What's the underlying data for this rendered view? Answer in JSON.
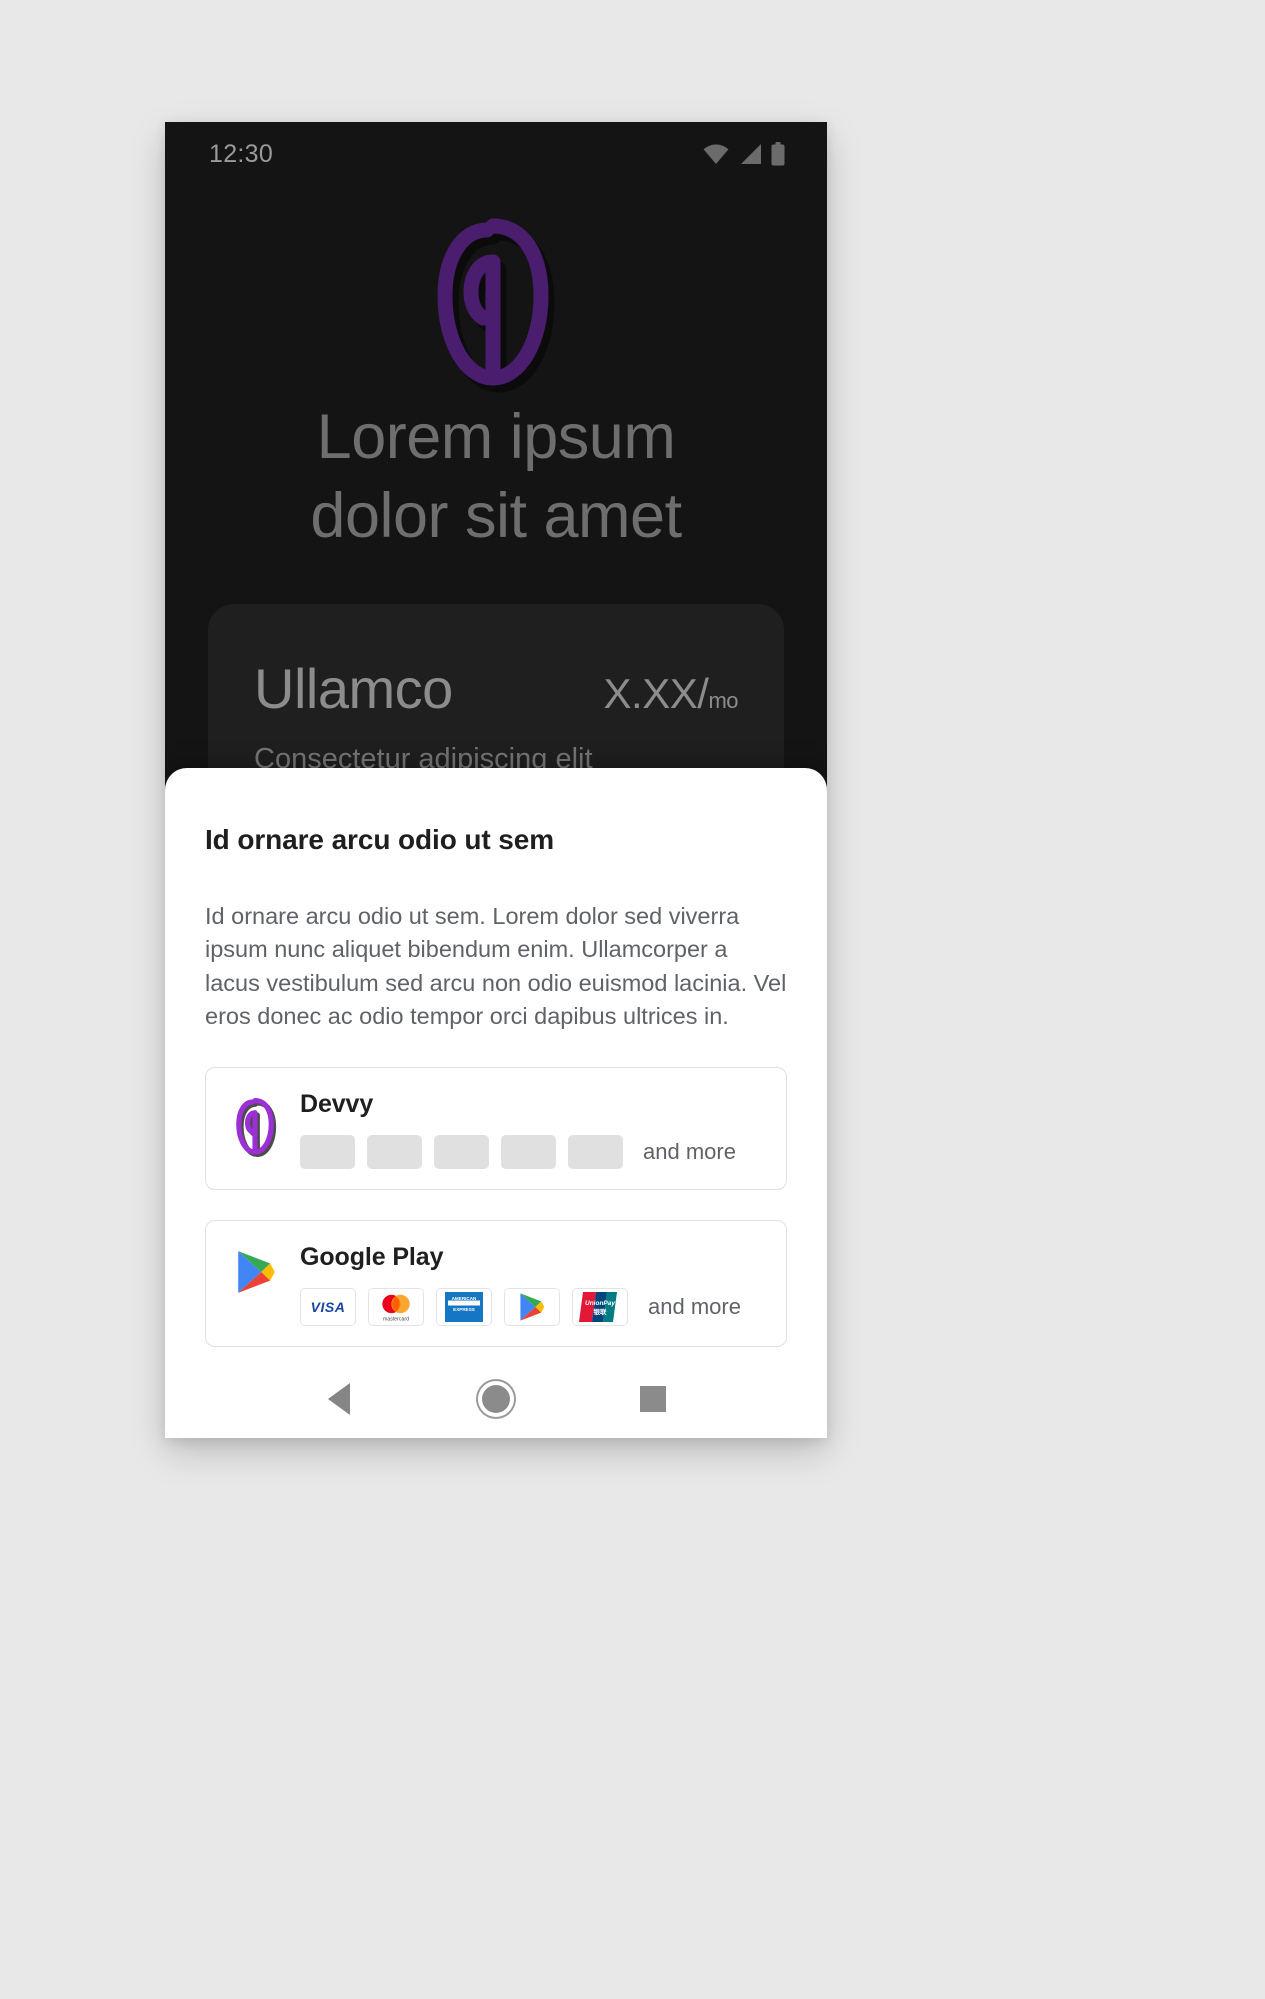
{
  "theme": {
    "page_bg": "#e8e8e8",
    "phone_bg": "#141414",
    "brand_purple_dark": "#4a1d6e",
    "brand_purple_light": "#9c2fd6",
    "sheet_bg": "#ffffff",
    "muted_text": "#5f6368"
  },
  "statusbar": {
    "time": "12:30",
    "icons": [
      "wifi-icon",
      "cell-signal-icon",
      "battery-icon"
    ]
  },
  "hero": {
    "logo_name": "devvy-logo",
    "title_line1": "Lorem ipsum",
    "title_line2": "dolor sit amet"
  },
  "plan_card": {
    "name": "Ullamco",
    "price": "X.XX/",
    "price_unit": "mo",
    "subtitle": "Consectetur adipiscing elit"
  },
  "sheet": {
    "title": "Id ornare arcu odio ut sem",
    "body": "Id ornare arcu odio ut sem. Lorem dolor sed viverra ipsum nunc aliquet bibendum enim. Ullamcorper a lacus vestibulum sed arcu non odio euismod lacinia. Vel eros donec ac odio tempor orci dapibus ultrices in.",
    "providers": [
      {
        "name": "Devvy",
        "logo_name": "devvy-logo",
        "methods": [
          "placeholder-chip",
          "placeholder-chip",
          "placeholder-chip",
          "placeholder-chip",
          "placeholder-chip"
        ],
        "more_label": "and more"
      },
      {
        "name": "Google Play",
        "logo_name": "google-play-logo",
        "methods": [
          "visa-icon",
          "mastercard-icon",
          "amex-icon",
          "google-play-icon",
          "unionpay-icon"
        ],
        "more_label": "and more"
      }
    ]
  },
  "navbar": {
    "back_label": "back-button",
    "home_label": "home-button",
    "recents_label": "recents-button"
  }
}
